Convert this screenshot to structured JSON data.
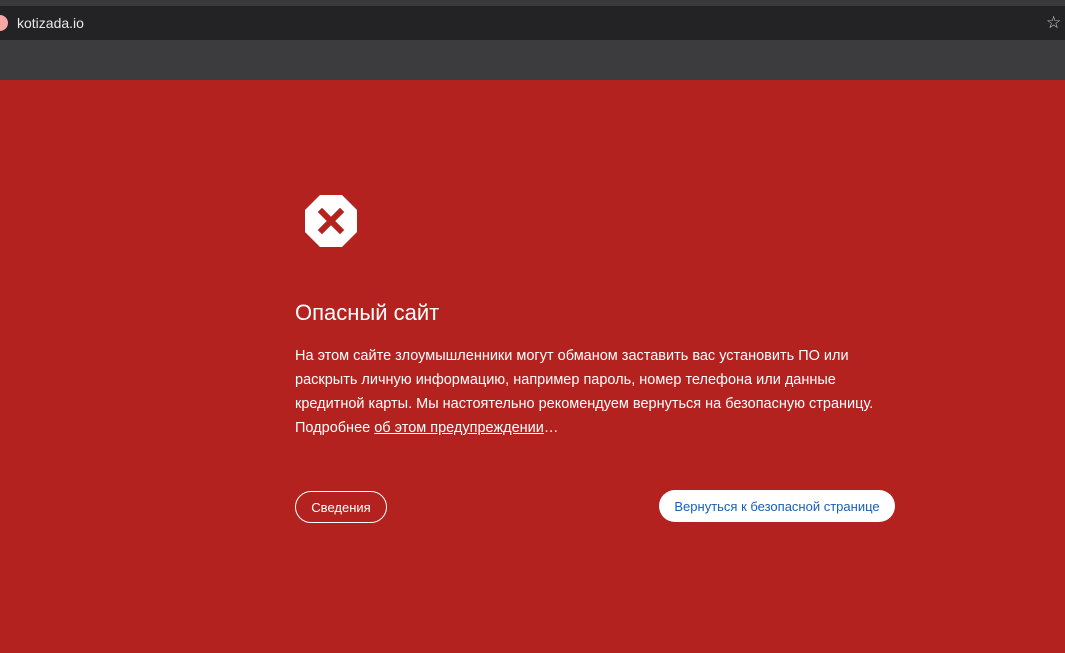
{
  "browser": {
    "url": "kotizada.io",
    "favicon": "site-favicon",
    "bookmark_icon": "star-icon"
  },
  "warning": {
    "icon": "danger-octagon-x-icon",
    "title": "Опасный сайт",
    "line1": "На этом сайте злоумышленники могут обманом заставить вас установить ПО или",
    "line2": "раскрыть личную информацию, например пароль, номер телефона или данные",
    "line3": "кредитной карты. Мы настоятельно рекомендуем вернуться на безопасную страницу.",
    "line4_prefix": "Подробнее ",
    "learn_more_link": "об этом предупреждении",
    "line4_suffix": "…",
    "details_button": "Сведения",
    "back_button": "Вернуться к безопасной странице"
  },
  "colors": {
    "page_background": "#b3221f",
    "address_bar": "#232325",
    "toolbar": "#3c3c3e",
    "primary_button_text": "#1a5fb4"
  }
}
